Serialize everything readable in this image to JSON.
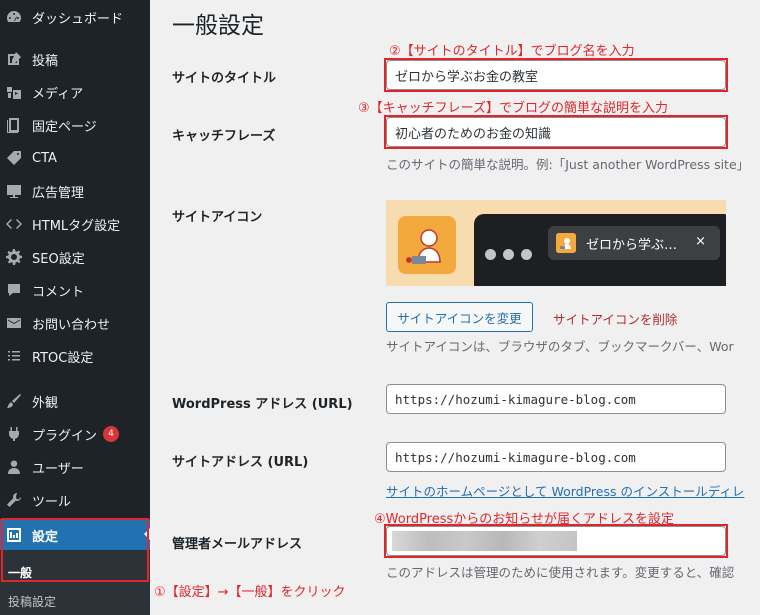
{
  "sidebar": {
    "items": [
      {
        "label": "ダッシュボード",
        "icon": "dashboard-icon"
      },
      {
        "label": "投稿",
        "icon": "pin-icon"
      },
      {
        "label": "メディア",
        "icon": "media-icon"
      },
      {
        "label": "固定ページ",
        "icon": "page-icon"
      },
      {
        "label": "CTA",
        "icon": "tag-icon"
      },
      {
        "label": "広告管理",
        "icon": "ad-icon"
      },
      {
        "label": "HTMLタグ設定",
        "icon": "code-icon"
      },
      {
        "label": "SEO設定",
        "icon": "gear-icon"
      },
      {
        "label": "コメント",
        "icon": "comment-icon"
      },
      {
        "label": "お問い合わせ",
        "icon": "mail-icon"
      },
      {
        "label": "RTOC設定",
        "icon": "list-icon"
      },
      {
        "label": "外観",
        "icon": "brush-icon"
      },
      {
        "label": "プラグイン",
        "icon": "plugin-icon",
        "badge": "4"
      },
      {
        "label": "ユーザー",
        "icon": "user-icon"
      },
      {
        "label": "ツール",
        "icon": "wrench-icon"
      },
      {
        "label": "設定",
        "icon": "settings-icon",
        "active": true
      }
    ],
    "submenu": {
      "current": "一般",
      "next": "投稿設定"
    }
  },
  "page": {
    "title": "一般設定",
    "site_title_label": "サイトのタイトル",
    "site_title_value": "ゼロから学ぶお金の教室",
    "tagline_label": "キャッチフレーズ",
    "tagline_value": "初心者のためのお金の知識",
    "tagline_desc": "このサイトの簡単な説明。例:「Just another WordPress site」",
    "site_icon_label": "サイトアイコン",
    "preview_tab_title": "ゼロから学ぶ…",
    "preview_tab_close": "×",
    "change_icon_button": "サイトアイコンを変更",
    "delete_icon_link": "サイトアイコンを削除",
    "site_icon_desc": "サイトアイコンは、ブラウザのタブ、ブックマークバー、Wor",
    "wp_address_label": "WordPress アドレス (URL)",
    "wp_address_value": "https://hozumi-kimagure-blog.com",
    "site_address_label": "サイトアドレス (URL)",
    "site_address_value": "https://hozumi-kimagure-blog.com",
    "site_address_link": "サイトのホームページとして WordPress のインストールディレ",
    "admin_email_label": "管理者メールアドレス",
    "admin_email_desc": "このアドレスは管理のために使用されます。変更すると、確認"
  },
  "annotations": {
    "a1": "①【設定】→【一般】をクリック",
    "a2": "②【サイトのタイトル】でブログ名を入力",
    "a3": "③【キャッチフレーズ】でブログの簡単な説明を入力",
    "a4": "④WordPressからのお知らせが届くアドレスを設定"
  },
  "colors": {
    "sidebar_bg": "#1d2327",
    "active_bg": "#2271b1",
    "annotation_red": "#e0262b",
    "badge_red": "#d63638"
  }
}
